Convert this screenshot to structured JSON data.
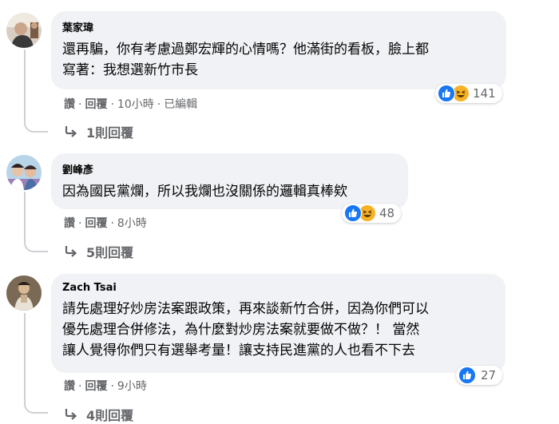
{
  "comments": [
    {
      "author": "葉家瑋",
      "text": "還再騙，你有考慮過鄭宏輝的心情嗎？他滿街的看板，臉上都\n寫著：我想選新竹市長",
      "reactions": [
        "like",
        "haha"
      ],
      "reaction_count": "141",
      "actions": {
        "like": "讚",
        "reply": "回覆",
        "time": "10小時",
        "edited": "已編輯"
      },
      "replies_label": "1則回覆"
    },
    {
      "author": "劉峰彥",
      "text": "因為國民黨爛，所以我爛也沒關係的邏輯真棒欸",
      "reactions": [
        "like",
        "haha"
      ],
      "reaction_count": "48",
      "actions": {
        "like": "讚",
        "reply": "回覆",
        "time": "8小時"
      },
      "replies_label": "5則回覆"
    },
    {
      "author": "Zach Tsai",
      "text": "請先處理好炒房法案跟政策，再來談新竹合併，因為你們可以\n優先處理合併修法，為什麼對炒房法案就要做不做？！ 當然\n讓人覺得你們只有選舉考量！讓支持民進黨的人也看不下去",
      "reactions": [
        "like"
      ],
      "reaction_count": "27",
      "actions": {
        "like": "讚",
        "reply": "回覆",
        "time": "9小時"
      },
      "replies_label": "4則回覆"
    }
  ],
  "colors": {
    "bubble": "#f0f2f5",
    "like_blue": "#1877f2",
    "haha_yellow": "#f7b125",
    "meta_gray": "#65676b"
  },
  "icons": [
    "like-reaction-icon",
    "haha-reaction-icon",
    "reply-arrow-icon"
  ]
}
